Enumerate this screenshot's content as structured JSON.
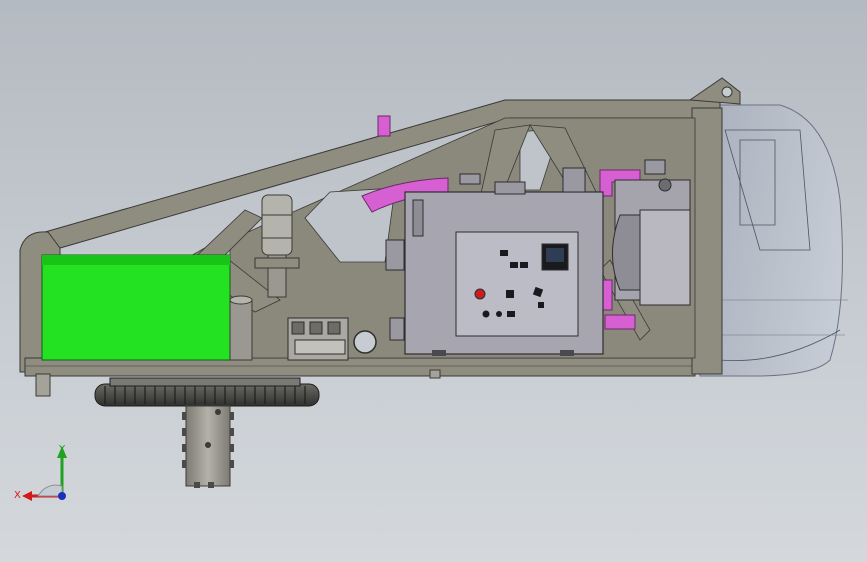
{
  "viewport": {
    "background_top": "#b4bac1",
    "background_bottom": "#d4d8dc"
  },
  "model": {
    "frame_color": "#8f8c80",
    "frame_edge_color": "#3a3a36",
    "tank_color": "#22e222",
    "cabinet_color": "#a7a6b0",
    "panel_color": "#bcbcc6",
    "hose_color": "#d65fd2",
    "cover_color": "#aeb6c6",
    "gear_color": "#4a4a48",
    "shaft_color": "#9a9890",
    "components": [
      {
        "name": "hydraulic-tank",
        "icon": "tank-icon"
      },
      {
        "name": "control-cabinet",
        "icon": "cabinet-icon"
      },
      {
        "name": "cylinder",
        "icon": "cylinder-icon"
      },
      {
        "name": "slewing-ring-gear",
        "icon": "gear-icon"
      },
      {
        "name": "drive-shaft",
        "icon": "shaft-icon"
      },
      {
        "name": "pump-motor",
        "icon": "motor-icon"
      },
      {
        "name": "front-cover",
        "icon": "cover-icon"
      }
    ]
  },
  "triad": {
    "x_label": "X",
    "y_label": "Y",
    "x_color": "#d21a1a",
    "y_color": "#1fa21f",
    "z_color": "#1b2fbf"
  }
}
